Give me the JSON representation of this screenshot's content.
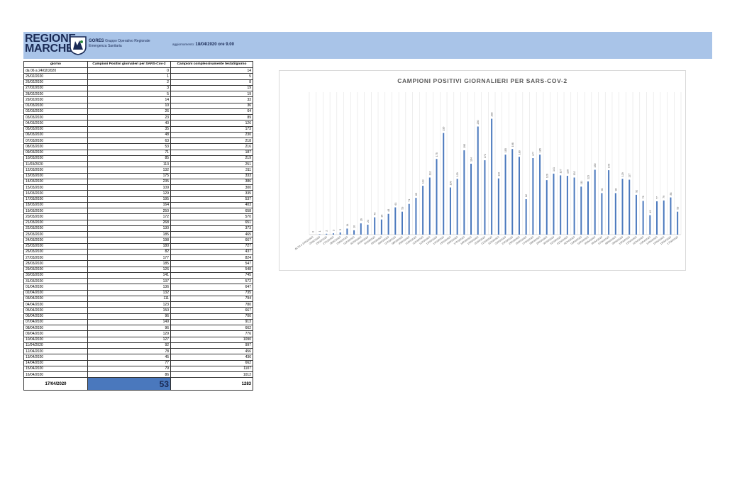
{
  "header": {
    "logo_line1": "REGIONE",
    "logo_line2": "MARCHE",
    "org_name": "GORES",
    "org_desc1": "Gruppo Operativo Regionale",
    "org_desc2": "Emergenza Sanitaria",
    "update_label": "aggiornamento:",
    "update_value": "18/04/2020 ore 9.00"
  },
  "table": {
    "headers": [
      "giorno",
      "Campioni Positivi giornalieri per SARS-Cov-2",
      "Campioni complessivamente testati/giorno"
    ],
    "rows": [
      [
        "da 06 a 24/02/2020",
        "0",
        "14"
      ],
      [
        "25/02/2020",
        "1",
        "5"
      ],
      [
        "26/02/2020",
        "2",
        "8"
      ],
      [
        "27/02/2020",
        "3",
        "19"
      ],
      [
        "28/02/2020",
        "5",
        "19"
      ],
      [
        "29/02/2020",
        "14",
        "33"
      ],
      [
        "01/03/2020",
        "10",
        "36"
      ],
      [
        "02/03/2020",
        "26",
        "64"
      ],
      [
        "03/03/2020",
        "23",
        "89"
      ],
      [
        "04/03/2020",
        "40",
        "126"
      ],
      [
        "05/03/2020",
        "35",
        "173"
      ],
      [
        "06/03/2020",
        "48",
        "230"
      ],
      [
        "07/03/2020",
        "63",
        "218"
      ],
      [
        "08/03/2020",
        "53",
        "216"
      ],
      [
        "09/03/2020",
        "71",
        "187"
      ],
      [
        "10/03/2020",
        "85",
        "219"
      ],
      [
        "11/03/2020",
        "113",
        "251"
      ],
      [
        "12/03/2020",
        "132",
        "311"
      ],
      [
        "13/03/2020",
        "175",
        "333"
      ],
      [
        "14/03/2020",
        "235",
        "386"
      ],
      [
        "15/03/2020",
        "109",
        "300"
      ],
      [
        "16/03/2020",
        "129",
        "335"
      ],
      [
        "17/03/2020",
        "195",
        "537"
      ],
      [
        "18/03/2020",
        "164",
        "403"
      ],
      [
        "19/03/2020",
        "250",
        "658"
      ],
      [
        "20/03/2020",
        "172",
        "570"
      ],
      [
        "21/03/2020",
        "268",
        "651"
      ],
      [
        "22/03/2020",
        "130",
        "373"
      ],
      [
        "23/03/2020",
        "185",
        "465"
      ],
      [
        "24/03/2020",
        "198",
        "667"
      ],
      [
        "25/03/2020",
        "180",
        "727"
      ],
      [
        "26/03/2020",
        "82",
        "437"
      ],
      [
        "27/03/2020",
        "177",
        "824"
      ],
      [
        "28/03/2020",
        "185",
        "547"
      ],
      [
        "29/03/2020",
        "126",
        "548"
      ],
      [
        "30/03/2020",
        "141",
        "745"
      ],
      [
        "31/03/2020",
        "137",
        "572"
      ],
      [
        "01/04/2020",
        "136",
        "647"
      ],
      [
        "02/04/2020",
        "132",
        "735"
      ],
      [
        "03/04/2020",
        "111",
        "794"
      ],
      [
        "04/04/2020",
        "123",
        "780"
      ],
      [
        "05/04/2020",
        "150",
        "667"
      ],
      [
        "06/04/2020",
        "96",
        "700"
      ],
      [
        "07/04/2020",
        "149",
        "913"
      ],
      [
        "08/04/2020",
        "96",
        "662"
      ],
      [
        "09/04/2020",
        "129",
        "776"
      ],
      [
        "10/04/2020",
        "127",
        "1090"
      ],
      [
        "11/04/2020",
        "92",
        "997"
      ],
      [
        "12/04/2020",
        "78",
        "456"
      ],
      [
        "13/04/2020",
        "45",
        "436"
      ],
      [
        "14/04/2020",
        "77",
        "662"
      ],
      [
        "15/04/2020",
        "79",
        "1107"
      ],
      [
        "16/04/2020",
        "86",
        "1012"
      ]
    ],
    "last_row": [
      "17/04/2020",
      "53",
      "1283"
    ]
  },
  "colors": {
    "banner": "#a9c4e8",
    "bar": "#4a78bd",
    "highlight": "#4a78bd"
  },
  "chart_data": {
    "type": "bar",
    "title": "CAMPIONI POSITIVI GIORNALIERI PER SARS-COV-2",
    "xlabel": "",
    "ylabel": "",
    "grid": "vertical",
    "legend": "none",
    "categories": [
      "da 06 a 24/02/2020",
      "25/02/2020",
      "26/02/2020",
      "27/02/2020",
      "28/02/2020",
      "29/02/2020",
      "01/03/2020",
      "02/03/2020",
      "03/03/2020",
      "04/03/2020",
      "05/03/2020",
      "06/03/2020",
      "07/03/2020",
      "08/03/2020",
      "09/03/2020",
      "10/03/2020",
      "11/03/2020",
      "12/03/2020",
      "13/03/2020",
      "14/03/2020",
      "15/03/2020",
      "16/03/2020",
      "17/03/2020",
      "18/03/2020",
      "19/03/2020",
      "20/03/2020",
      "21/03/2020",
      "22/03/2020",
      "23/03/2020",
      "24/03/2020",
      "25/03/2020",
      "26/03/2020",
      "27/03/2020",
      "28/03/2020",
      "29/03/2020",
      "30/03/2020",
      "31/03/2020",
      "01/04/2020",
      "02/04/2020",
      "03/04/2020",
      "04/04/2020",
      "05/04/2020",
      "06/04/2020",
      "07/04/2020",
      "08/04/2020",
      "09/04/2020",
      "10/04/2020",
      "11/04/2020",
      "12/04/2020",
      "13/04/2020",
      "14/04/2020",
      "15/04/2020",
      "16/04/2020",
      "17/04/2020"
    ],
    "values": [
      0,
      1,
      2,
      3,
      5,
      14,
      10,
      26,
      23,
      40,
      35,
      48,
      63,
      53,
      71,
      85,
      113,
      132,
      175,
      235,
      109,
      129,
      195,
      164,
      250,
      172,
      268,
      130,
      185,
      198,
      180,
      82,
      177,
      185,
      126,
      141,
      137,
      136,
      132,
      111,
      123,
      150,
      96,
      149,
      96,
      129,
      127,
      92,
      78,
      45,
      77,
      79,
      86,
      53
    ],
    "ylim": [
      0,
      300
    ]
  }
}
